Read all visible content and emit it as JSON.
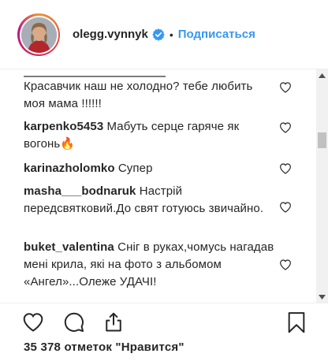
{
  "header": {
    "username": "olegg.vynnyk",
    "separator": "•",
    "follow_label": "Подписаться",
    "avatar_icon": "profile-photo",
    "verified_icon": "verified-badge-icon",
    "accent_color": "#3897f0"
  },
  "comments": [
    {
      "author": "",
      "text": "Красавчик наш не холодно? тебе любить моя мама !!!!!!"
    },
    {
      "author": "karpenko5453",
      "text": "Мабуть серце гаряче як вогонь🔥"
    },
    {
      "author": "karinazholomko",
      "text": "Супер"
    },
    {
      "author": "masha___bodnaruk",
      "text": "Настрій передсвятковий.До свят готуюсь звичайно."
    },
    {
      "author": "buket_valentina",
      "text": "Сніг в руках,чомусь нагадав мені крила, які на фото з альбомом «Ангел»...Олеже УДАЧІ!"
    }
  ],
  "actions": {
    "like_icon": "heart-icon",
    "comment_icon": "comment-icon",
    "share_icon": "share-icon",
    "save_icon": "bookmark-icon",
    "likes_text": "35 378 отметок \"Нравится\""
  }
}
